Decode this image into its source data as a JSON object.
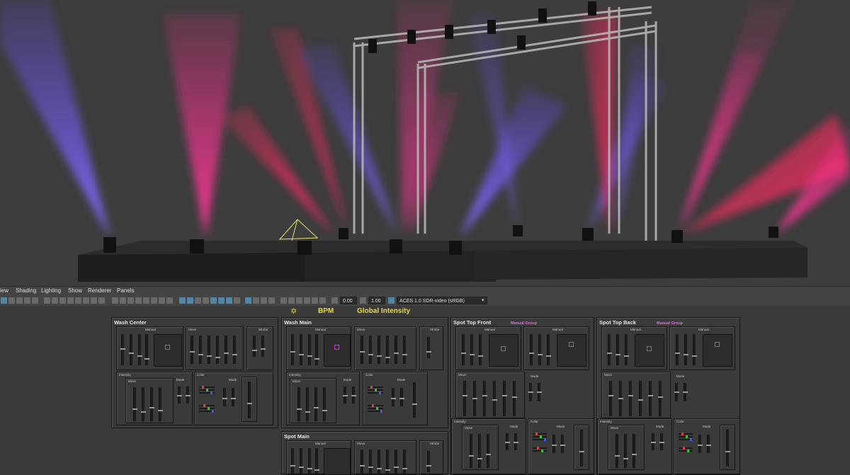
{
  "menubar": {
    "items": [
      {
        "label": "iew"
      },
      {
        "label": "Shading"
      },
      {
        "label": "Lighting"
      },
      {
        "label": "Show"
      },
      {
        "label": "Renderer"
      },
      {
        "label": "Panels"
      }
    ]
  },
  "toolbar": {
    "exposure": "0.00",
    "gamma": "1.00",
    "color_space": "ACES 1.0 SDR-video (sRGB)"
  },
  "header": {
    "bpm_label": "BPM",
    "global_label": "Global Intensity"
  },
  "panels": [
    {
      "title": "Wash Center",
      "manual": "Manual",
      "move": "Move",
      "strobe": "Strobe",
      "intensity": "Intensity",
      "color": "Color",
      "mode": "Mode",
      "move_inner": "Move"
    },
    {
      "title": "Wash Main",
      "manual": "Manual",
      "move": "Move",
      "strobe": "Strobe",
      "intensity": "Intensity",
      "color": "Color",
      "mode": "Mode",
      "move_inner": "Move"
    },
    {
      "title": "Spot Top Front",
      "subtitle": "Manual Group",
      "manual": "Manual",
      "move": "Move",
      "mode": "Mode",
      "intensity": "Intensity",
      "color": "Color",
      "move_inner": "Move"
    },
    {
      "title": "Spot Top Back",
      "subtitle": "Manual Group",
      "manual": "Manual",
      "move": "Move",
      "mode": "Mode",
      "intensity": "Intensity",
      "color": "Color",
      "move_inner": "Move"
    },
    {
      "title": "Spot Main",
      "manual": "Manual",
      "move": "Move",
      "strobe": "Strobe"
    }
  ],
  "colors": {
    "beam_pink": "#ff2a8c",
    "beam_blue": "#7a5cff",
    "header_yellow": "#e8dc3c",
    "subtitle_magenta": "#e070e0"
  }
}
